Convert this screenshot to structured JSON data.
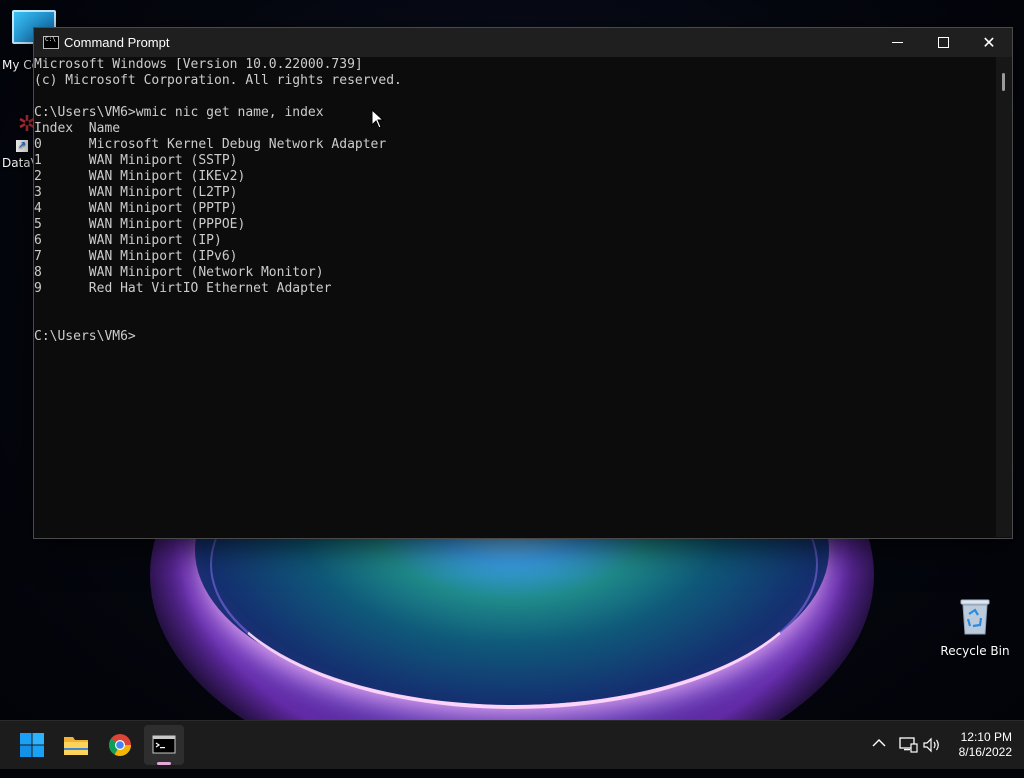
{
  "desktop": {
    "icons": [
      {
        "label": "My Co"
      },
      {
        "label": "DataV"
      },
      {
        "label": "Recycle Bin"
      }
    ]
  },
  "window": {
    "title": "Command Prompt",
    "controls": {
      "minimize": "minimize",
      "maximize": "maximize",
      "close": "close"
    }
  },
  "console": {
    "lines": [
      "Microsoft Windows [Version 10.0.22000.739]",
      "(c) Microsoft Corporation. All rights reserved.",
      "",
      "C:\\Users\\VM6>wmic nic get name, index",
      "Index  Name",
      "0      Microsoft Kernel Debug Network Adapter",
      "1      WAN Miniport (SSTP)",
      "2      WAN Miniport (IKEv2)",
      "3      WAN Miniport (L2TP)",
      "4      WAN Miniport (PPTP)",
      "5      WAN Miniport (PPPOE)",
      "6      WAN Miniport (IP)",
      "7      WAN Miniport (IPv6)",
      "8      WAN Miniport (Network Monitor)",
      "9      Red Hat VirtIO Ethernet Adapter",
      "",
      "",
      "C:\\Users\\VM6>"
    ]
  },
  "taskbar": {
    "apps": [
      "start-icon",
      "file-explorer-icon",
      "chrome-icon",
      "command-prompt-icon"
    ],
    "clock": {
      "time": "12:10 PM",
      "date": "8/16/2022"
    }
  },
  "colors": {
    "console_bg": "#0c0c0c",
    "console_text": "#cccccc",
    "titlebar_bg": "#1f1f1f",
    "taskbar_bg": "#1c1c1c"
  }
}
